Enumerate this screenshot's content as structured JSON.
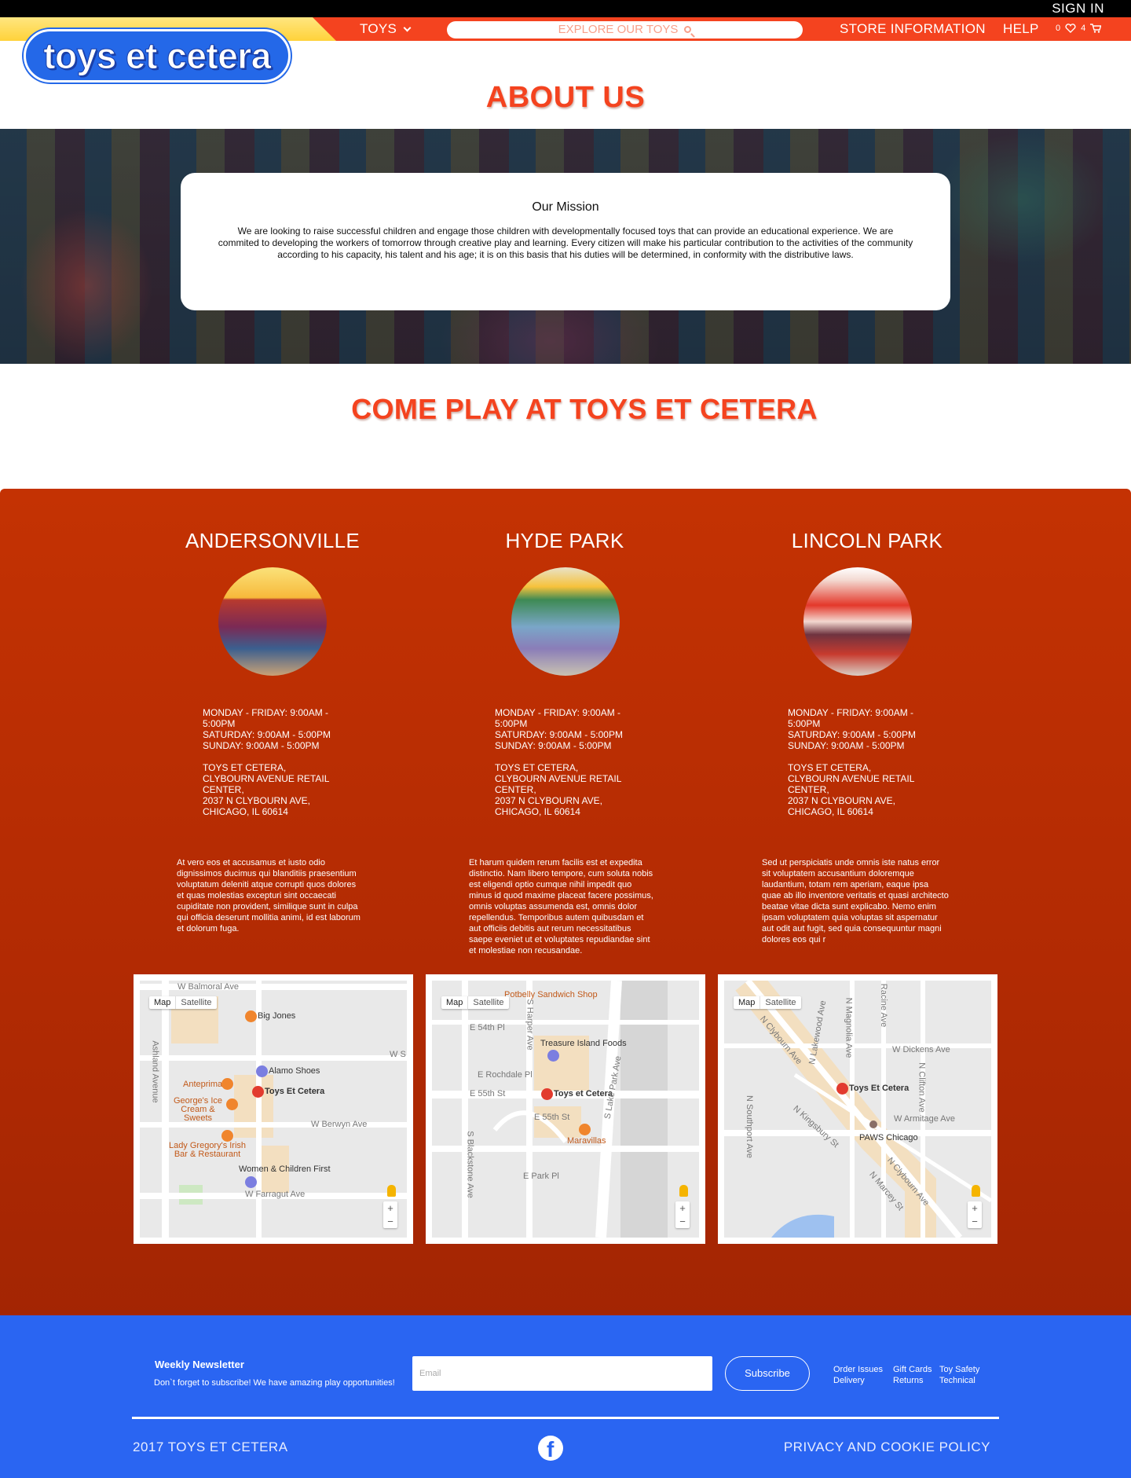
{
  "header": {
    "sign_in": "SIGN IN",
    "logo_text": "toys et cetera",
    "nav": {
      "toys": "TOYS",
      "search_placeholder": "EXPLORE OUR TOYS",
      "store_info": "STORE INFORMATION",
      "help": "HELP",
      "wishlist_count": "0",
      "cart_count": "4"
    }
  },
  "about": {
    "title": "ABOUT US",
    "mission_title": "Our Mission",
    "mission_text": "We are looking to raise successful children and engage those children with developmentally focused toys that can provide an educational experience. We are commited to developing the workers of tomorrow through creative play and learning.  Every citizen will make his particular contribution to the activities of the community according to his capacity, his talent and his age; it is on this basis that his duties will be determined, in conformity with the distributive laws."
  },
  "locations_section": {
    "title": "COME PLAY AT TOYS ET CETERA",
    "locations": [
      {
        "name": "ANDERSONVILLE",
        "hours_weekday": "MONDAY - FRIDAY: 9:00AM - 5:00PM",
        "hours_saturday": "SATURDAY: 9:00AM - 5:00PM",
        "hours_sunday": "SUNDAY: 9:00AM - 5:00PM",
        "address_line1": "TOYS ET CETERA,",
        "address_line2": "CLYBOURN AVENUE RETAIL CENTER,",
        "address_line3": "2037 N CLYBOURN AVE,",
        "address_line4": "CHICAGO, IL 60614",
        "description": "At vero eos et accusamus et iusto odio dignissimos ducimus qui blanditiis praesentium voluptatum deleniti atque corrupti quos dolores et quas molestias excepturi sint occaecati cupiditate non provident, similique sunt in culpa qui officia deserunt mollitia animi, id est laborum et dolorum fuga.",
        "map": {
          "map_btn": "Map",
          "satellite_btn": "Satellite",
          "labels": [
            "W Balmoral Ave",
            "Big Jones",
            "Alamo Shoes",
            "Anteprima",
            "Toys Et Cetera",
            "George's Ice Cream & Sweets",
            "W Berwyn Ave",
            "Lady Gregory's Irish Bar & Restaurant",
            "Women & Children First",
            "W Farragut Ave",
            "Ashland Avenue",
            "W S"
          ]
        }
      },
      {
        "name": "HYDE PARK",
        "hours_weekday": "MONDAY - FRIDAY: 9:00AM - 5:00PM",
        "hours_saturday": "SATURDAY: 9:00AM - 5:00PM",
        "hours_sunday": "SUNDAY: 9:00AM - 5:00PM",
        "address_line1": "TOYS ET CETERA,",
        "address_line2": "CLYBOURN AVENUE RETAIL CENTER,",
        "address_line3": "2037 N CLYBOURN AVE,",
        "address_line4": "CHICAGO, IL 60614",
        "description": "Et harum quidem rerum facilis est et expedita distinctio. Nam libero tempore, cum soluta nobis est eligendi optio cumque nihil impedit quo minus id quod maxime placeat facere possimus, omnis voluptas assumenda est, omnis dolor repellendus. Temporibus autem quibusdam et aut officiis debitis aut rerum necessitatibus saepe eveniet ut et voluptates repudiandae sint et molestiae non recusandae.",
        "map": {
          "map_btn": "Map",
          "satellite_btn": "Satellite",
          "labels": [
            "Potbelly Sandwich Shop",
            "E 54th Pl",
            "Treasure Island Foods",
            "E Rochdale Pl",
            "E 55th St",
            "Toys et Cetera",
            "S Lake Park Ave",
            "E 55th St",
            "Maravillas",
            "E Park Pl",
            "S Blackstone Ave",
            "S Harper Ave"
          ]
        }
      },
      {
        "name": "LINCOLN PARK",
        "hours_weekday": "MONDAY - FRIDAY: 9:00AM - 5:00PM",
        "hours_saturday": "SATURDAY: 9:00AM - 5:00PM",
        "hours_sunday": "SUNDAY: 9:00AM - 5:00PM",
        "address_line1": "TOYS ET CETERA,",
        "address_line2": "CLYBOURN AVENUE RETAIL CENTER,",
        "address_line3": "2037 N CLYBOURN AVE,",
        "address_line4": "CHICAGO, IL 60614",
        "description": "Sed ut perspiciatis unde omnis iste natus error sit voluptatem accusantium doloremque laudantium, totam rem aperiam, eaque ipsa quae ab illo inventore veritatis et quasi architecto beatae vitae dicta sunt explicabo. Nemo enim ipsam voluptatem quia voluptas sit aspernatur aut odit aut fugit, sed quia consequuntur magni dolores eos qui r",
        "map": {
          "map_btn": "Map",
          "satellite_btn": "Satellite",
          "labels": [
            "N Clybourn Ave",
            "N Racine Ave",
            "W Dickens Ave",
            "N Magnolia Ave",
            "N Lakewood Ave",
            "Toys Et Cetera",
            "N Clifton Ave",
            "W Armitage Ave",
            "N Kingsbury St",
            "PAWS Chicago",
            "N Southport Ave",
            "N Clybourn Ave",
            "N Marcey St"
          ]
        }
      }
    ]
  },
  "footer": {
    "newsletter_title": "Weekly Newsletter",
    "newsletter_sub": "Don`t forget to subscribe! We have amazing play opportunities!",
    "email_placeholder": "Email",
    "subscribe": "Subscribe",
    "links_col1": [
      "Order Issues",
      "Delivery"
    ],
    "links_col2": [
      "Gift Cards",
      "Returns"
    ],
    "links_col3": [
      "Toy Safety",
      "Technical"
    ],
    "copyright": "2017 TOYS ET CETERA",
    "privacy": "PRIVACY AND COOKIE POLICY"
  },
  "colors": {
    "accent_red": "#f4431f",
    "section_red": "#c43203",
    "footer_blue": "#2a65f2",
    "logo_blue": "#2468e8"
  }
}
